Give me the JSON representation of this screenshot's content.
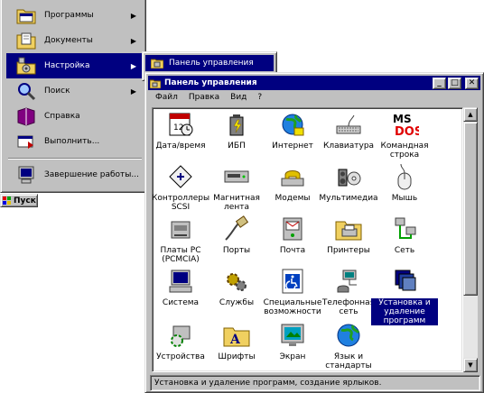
{
  "start_menu": {
    "items": [
      {
        "label": "Программы",
        "has_submenu": true,
        "icon": "programs-folder-icon"
      },
      {
        "label": "Документы",
        "has_submenu": true,
        "icon": "documents-folder-icon"
      },
      {
        "label": "Настройка",
        "has_submenu": true,
        "icon": "settings-icon",
        "active": true
      },
      {
        "label": "Поиск",
        "has_submenu": true,
        "icon": "search-icon"
      },
      {
        "label": "Справка",
        "has_submenu": false,
        "icon": "help-book-icon"
      },
      {
        "label": "Выполнить...",
        "has_submenu": false,
        "icon": "run-icon"
      },
      {
        "label": "Завершение работы...",
        "has_submenu": false,
        "icon": "shutdown-icon"
      }
    ],
    "arrow_glyph": "▶"
  },
  "start_button": {
    "label": "Пуск"
  },
  "submenu": {
    "items": [
      {
        "label": "Панель управления",
        "icon": "control-panel-folder-icon"
      }
    ]
  },
  "window": {
    "title": "Панель управления",
    "buttons": {
      "minimize": "_",
      "maximize": "□",
      "close": "✕"
    },
    "menu": [
      "Файл",
      "Правка",
      "Вид",
      "?"
    ],
    "status": "Установка и удаление программ, создание ярлыков.",
    "scroll_up": "▲",
    "scroll_down": "▼"
  },
  "control_panel": {
    "items": [
      {
        "label": "Дата/время",
        "icon": "calendar-clock-icon"
      },
      {
        "label": "ИБП",
        "icon": "ups-battery-icon"
      },
      {
        "label": "Интернет",
        "icon": "internet-globe-icon"
      },
      {
        "label": "Клавиатура",
        "icon": "keyboard-icon"
      },
      {
        "label": "Командная строка",
        "icon": "ms-dos-icon"
      },
      {
        "label": "Контроллеры SCSI",
        "icon": "scsi-controller-icon"
      },
      {
        "label": "Магнитная лента",
        "icon": "tape-drive-icon"
      },
      {
        "label": "Модемы",
        "icon": "modem-phone-icon"
      },
      {
        "label": "Мультимедиа",
        "icon": "multimedia-icon"
      },
      {
        "label": "Мышь",
        "icon": "mouse-icon"
      },
      {
        "label": "Платы PC (PCMCIA)",
        "icon": "pcmcia-card-icon"
      },
      {
        "label": "Порты",
        "icon": "ports-cable-icon"
      },
      {
        "label": "Почта",
        "icon": "mail-icon"
      },
      {
        "label": "Принтеры",
        "icon": "printers-folder-icon"
      },
      {
        "label": "Сеть",
        "icon": "network-icon"
      },
      {
        "label": "Система",
        "icon": "system-computer-icon"
      },
      {
        "label": "Службы",
        "icon": "services-gears-icon"
      },
      {
        "label": "Специальные возможности",
        "icon": "accessibility-icon"
      },
      {
        "label": "Телефонная сеть",
        "icon": "dialup-network-icon"
      },
      {
        "label": "Установка и удаление программ",
        "icon": "add-remove-programs-icon",
        "selected": true
      },
      {
        "label": "Устройства",
        "icon": "devices-icon"
      },
      {
        "label": "Шрифты",
        "icon": "fonts-folder-icon"
      },
      {
        "label": "Экран",
        "icon": "display-icon"
      },
      {
        "label": "Язык и стандарты",
        "icon": "regional-globe-icon"
      }
    ]
  },
  "colors": {
    "face": "#c0c0c0",
    "titlebar": "#000080",
    "highlight": "#000080",
    "window_bg": "#ffffff"
  }
}
